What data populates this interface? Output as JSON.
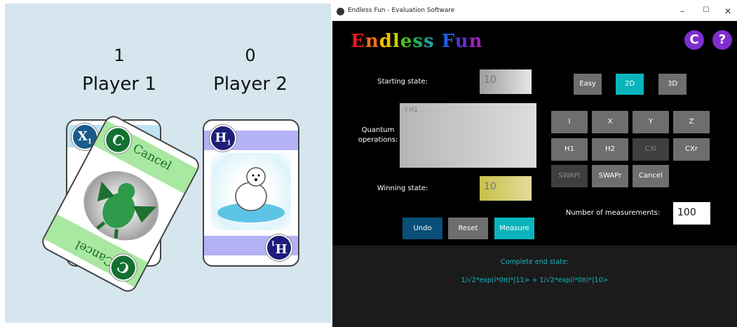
{
  "players": [
    {
      "score": "1",
      "name": "Player 1"
    },
    {
      "score": "0",
      "name": "Player 2"
    }
  ],
  "cards": {
    "back_gate": "X",
    "back_gate_sub": "1",
    "front_card_label": "Cancel",
    "front_badge": "C",
    "right_gate": "H",
    "right_gate_sub": "1"
  },
  "window": {
    "title": "Endless Fun - Evaluation Software",
    "controls": [
      "–",
      "☐",
      "✕"
    ]
  },
  "app": {
    "title_letters": [
      {
        "ch": "E",
        "color": "#e02020"
      },
      {
        "ch": "n",
        "color": "#f07010"
      },
      {
        "ch": "d",
        "color": "#f0c000"
      },
      {
        "ch": "l",
        "color": "#c8d000"
      },
      {
        "ch": "e",
        "color": "#50c020"
      },
      {
        "ch": "s",
        "color": "#20b060"
      },
      {
        "ch": "s",
        "color": "#20a0a0"
      },
      {
        "ch": " ",
        "color": "#000"
      },
      {
        "ch": "F",
        "color": "#2060e0"
      },
      {
        "ch": "u",
        "color": "#6030d0"
      },
      {
        "ch": "n",
        "color": "#a020c0"
      }
    ],
    "copyright_btn": "C",
    "help_btn": "?"
  },
  "form": {
    "starting_state_label": "Starting state:",
    "starting_state_value": "10",
    "quantum_label_1": "Quantum",
    "quantum_label_2": "operations:",
    "quantum_value": "I H1",
    "winning_state_label": "Winning state:",
    "winning_state_value": "10",
    "measurements_label": "Number of measurements:",
    "measurements_value": "100"
  },
  "difficulty": [
    "Easy",
    "2D",
    "3D"
  ],
  "gates": {
    "row1": [
      "I",
      "X",
      "Y",
      "Z"
    ],
    "row2": [
      "H1",
      "H2",
      "CXI",
      "CXr"
    ],
    "row3": [
      "SWAPI",
      "SWAPr",
      "Cancel"
    ]
  },
  "actions": {
    "undo": "Undo",
    "reset": "Reset",
    "measure": "Measure"
  },
  "result": {
    "heading": "Complete end state:",
    "state": "1/√2*exp(i*0π)*|11> + 1/√2*exp(i*0π)*|10>"
  },
  "colors": {
    "accent": "#08b5bd",
    "undo": "#0a4f7a",
    "purple": "#7d2fd0",
    "left_bg": "#d6e6ef"
  }
}
